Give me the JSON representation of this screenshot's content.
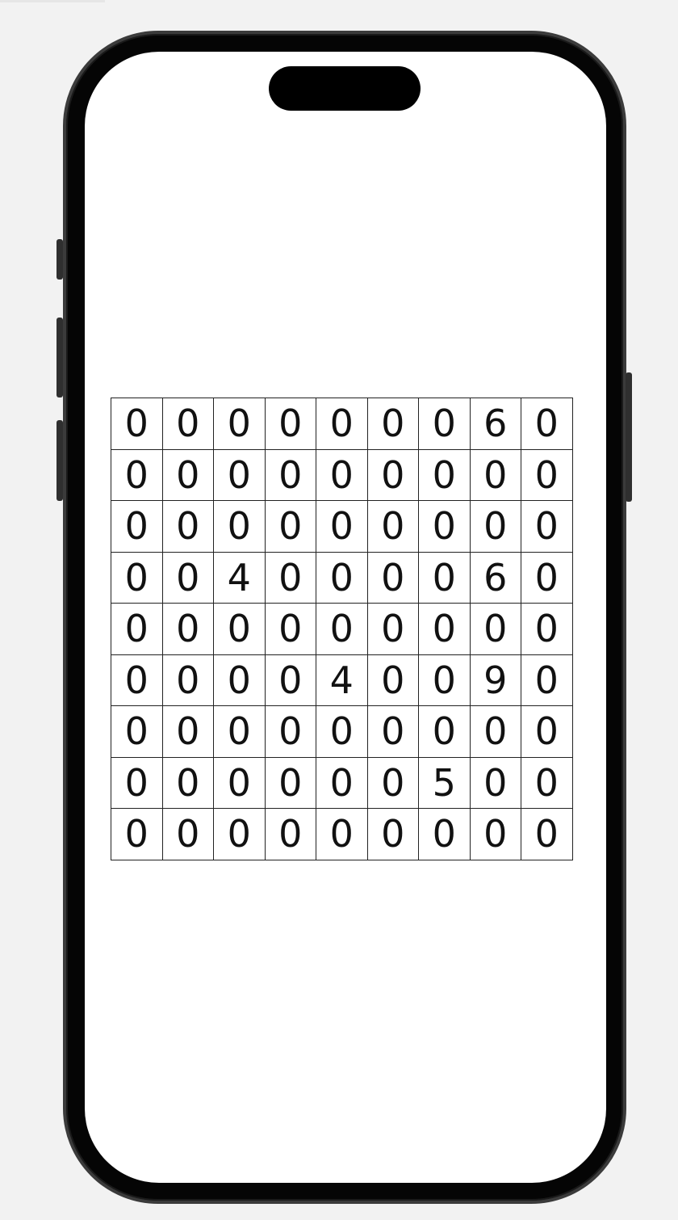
{
  "board": {
    "rows": [
      [
        "0",
        "0",
        "0",
        "0",
        "0",
        "0",
        "0",
        "6",
        "0"
      ],
      [
        "0",
        "0",
        "0",
        "0",
        "0",
        "0",
        "0",
        "0",
        "0"
      ],
      [
        "0",
        "0",
        "0",
        "0",
        "0",
        "0",
        "0",
        "0",
        "0"
      ],
      [
        "0",
        "0",
        "4",
        "0",
        "0",
        "0",
        "0",
        "6",
        "0"
      ],
      [
        "0",
        "0",
        "0",
        "0",
        "0",
        "0",
        "0",
        "0",
        "0"
      ],
      [
        "0",
        "0",
        "0",
        "0",
        "4",
        "0",
        "0",
        "9",
        "0"
      ],
      [
        "0",
        "0",
        "0",
        "0",
        "0",
        "0",
        "0",
        "0",
        "0"
      ],
      [
        "0",
        "0",
        "0",
        "0",
        "0",
        "0",
        "5",
        "0",
        "0"
      ],
      [
        "0",
        "0",
        "0",
        "0",
        "0",
        "0",
        "0",
        "0",
        "0"
      ]
    ]
  }
}
